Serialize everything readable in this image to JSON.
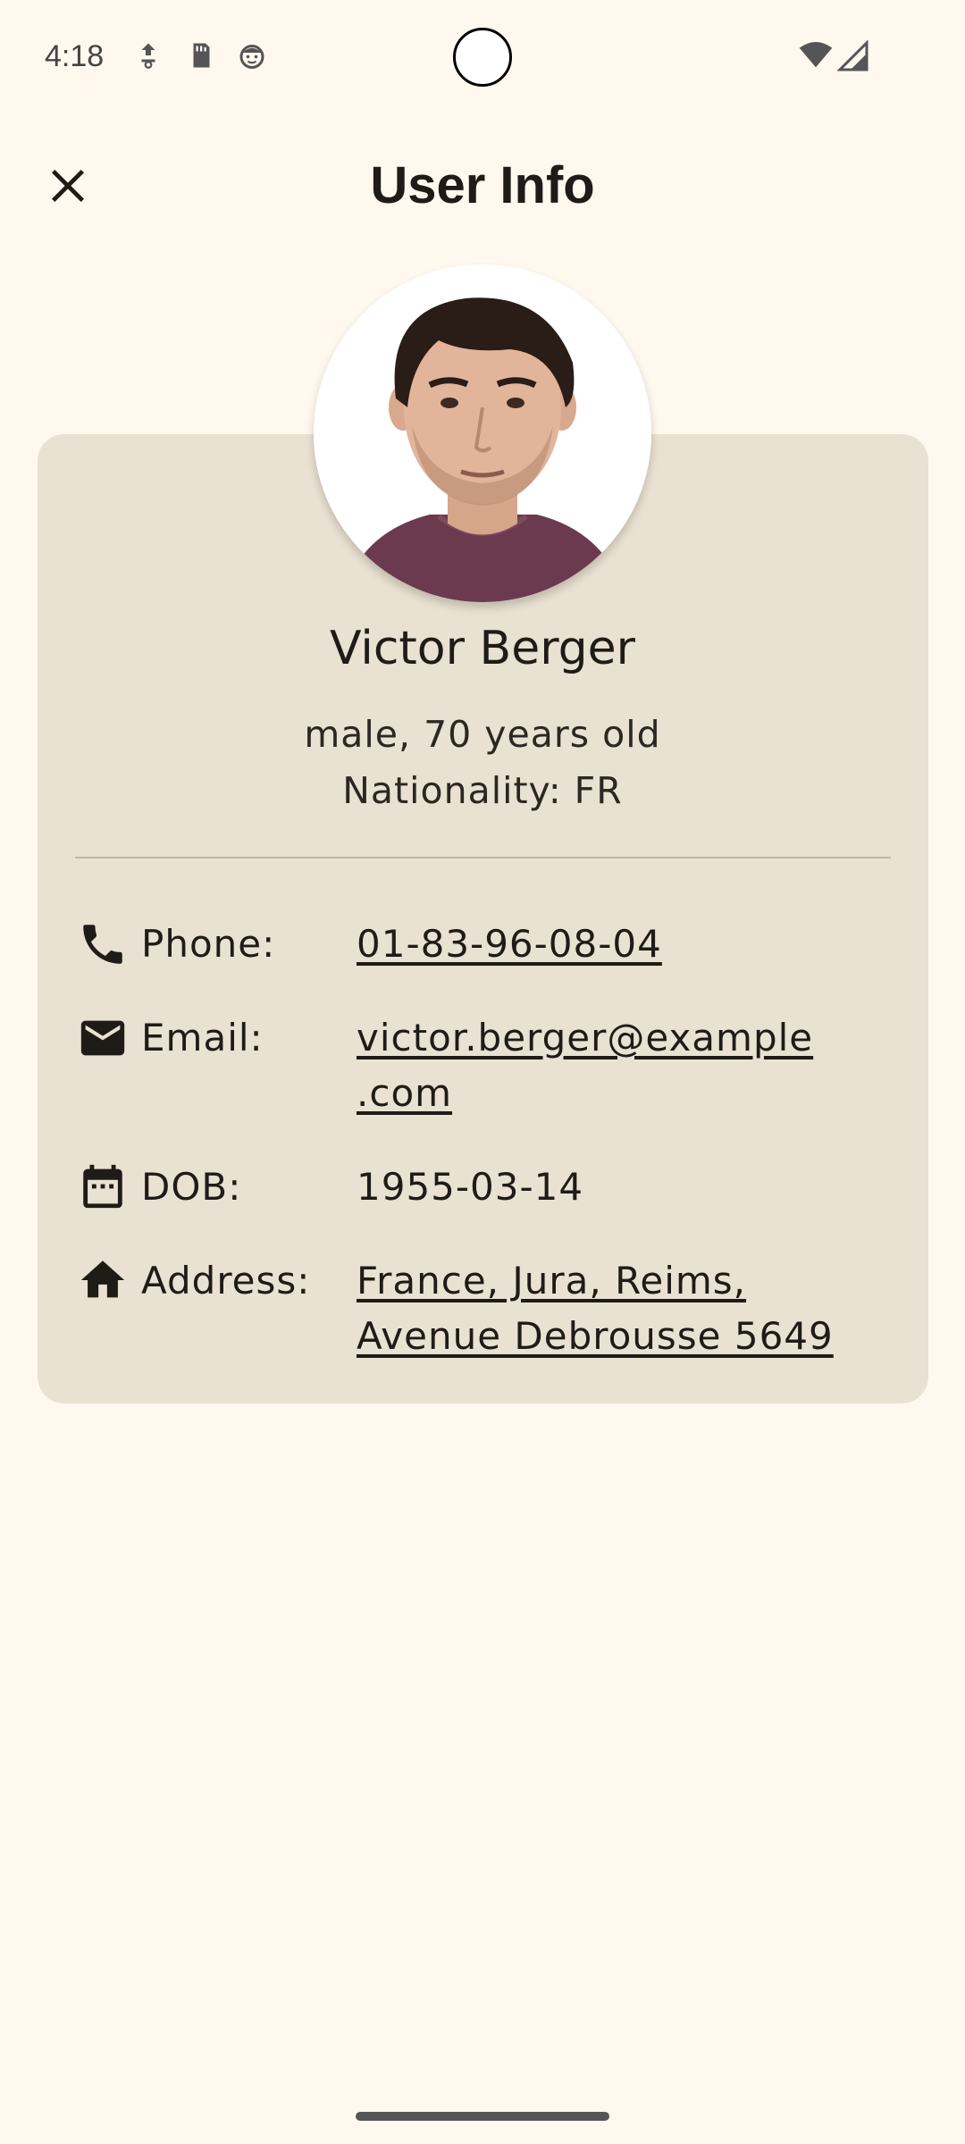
{
  "status_bar": {
    "time": "4:18",
    "icons": [
      "download-icon",
      "sd-card-icon",
      "face-icon",
      "wifi-icon",
      "signal-icon"
    ]
  },
  "header": {
    "title": "User Info",
    "close_icon": "close-icon"
  },
  "user": {
    "name": "Victor Berger",
    "summary": "male, 70 years old",
    "nationality": "Nationality: FR"
  },
  "details": {
    "phone": {
      "icon": "phone-icon",
      "label": "Phone:",
      "value": "01-83-96-08-04"
    },
    "email": {
      "icon": "email-icon",
      "label": "Email:",
      "value_line1": "victor.berger@example",
      "value_line2": ".com"
    },
    "dob": {
      "icon": "calendar-icon",
      "label": "DOB:",
      "value": "1955-03-14"
    },
    "address": {
      "icon": "home-icon",
      "label": "Address:",
      "value_line1": "France, Jura, Reims,",
      "value_line2": "Avenue Debrousse 5649"
    }
  },
  "colors": {
    "background": "#fff8ee",
    "card": "#e9e1d1",
    "text": "#1f1c17"
  }
}
